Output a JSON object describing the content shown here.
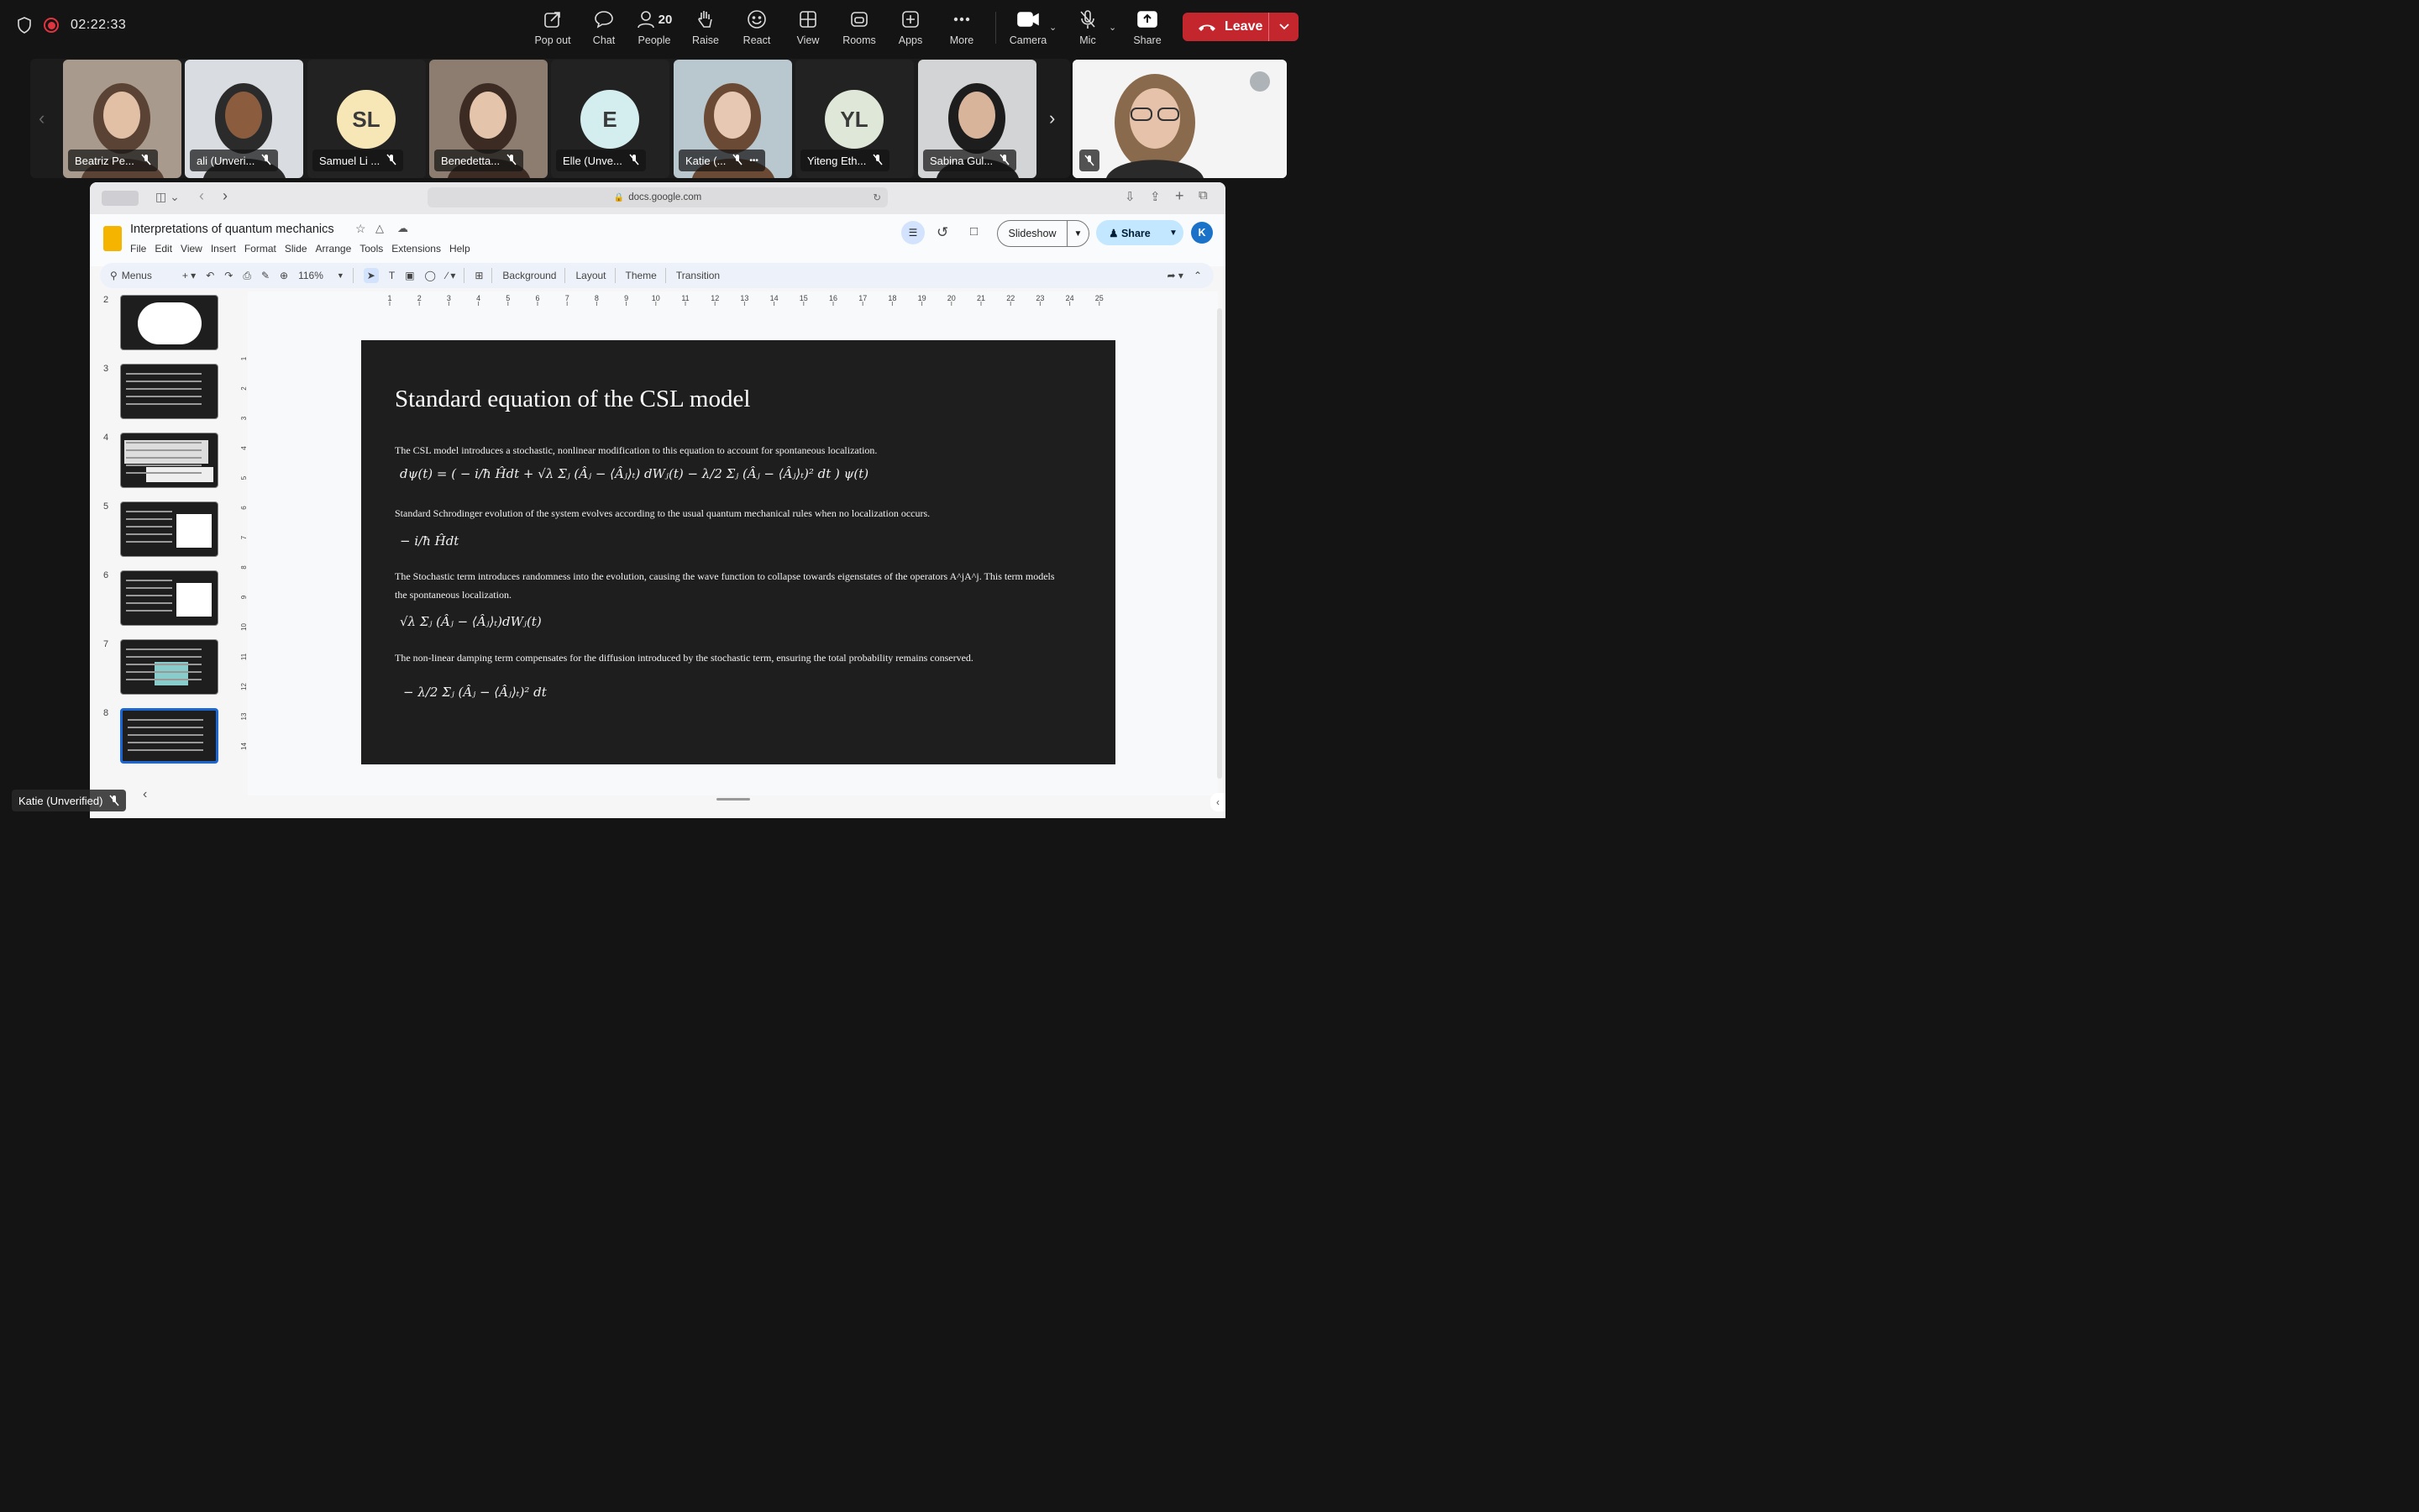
{
  "meeting": {
    "timer": "02:22:33",
    "toolbar": [
      {
        "label": "Pop out",
        "icon": "pop-out-icon"
      },
      {
        "label": "Chat",
        "icon": "chat-icon"
      },
      {
        "label": "People",
        "icon": "people-icon",
        "count": "20"
      },
      {
        "label": "Raise",
        "icon": "raise-hand-icon"
      },
      {
        "label": "React",
        "icon": "react-icon"
      },
      {
        "label": "View",
        "icon": "view-icon"
      },
      {
        "label": "Rooms",
        "icon": "rooms-icon"
      },
      {
        "label": "Apps",
        "icon": "apps-icon"
      },
      {
        "label": "More",
        "icon": "more-icon"
      },
      {
        "label": "Camera",
        "icon": "camera-icon"
      },
      {
        "label": "Mic",
        "icon": "mic-muted-icon"
      },
      {
        "label": "Share",
        "icon": "share-icon"
      }
    ],
    "leave_label": "Leave",
    "leave_color": "#c4262e"
  },
  "participants": [
    {
      "name": "Beatriz Pe...",
      "type": "video"
    },
    {
      "name": "ali (Unveri...",
      "type": "video"
    },
    {
      "name": "Samuel Li ...",
      "type": "avatar",
      "initials": "SL",
      "color": "#f7e7b6"
    },
    {
      "name": "Benedetta...",
      "type": "video"
    },
    {
      "name": "Elle (Unve...",
      "type": "avatar",
      "initials": "E",
      "color": "#d4eef0"
    },
    {
      "name": "Katie (...",
      "type": "video"
    },
    {
      "name": "Yiteng Eth...",
      "type": "avatar",
      "initials": "YL",
      "color": "#dfe8d8"
    },
    {
      "name": "Sabina Gul...",
      "type": "video"
    }
  ],
  "self_label": "Katie (Unverified)",
  "browser": {
    "url": "docs.google.com"
  },
  "docs": {
    "title": "Interpretations of quantum mechanics",
    "menus": [
      "File",
      "Edit",
      "View",
      "Insert",
      "Format",
      "Slide",
      "Arrange",
      "Tools",
      "Extensions",
      "Help"
    ],
    "slideshow_label": "Slideshow",
    "share_label": "Share",
    "account_initial": "K",
    "toolbar": {
      "menus_label": "Menus",
      "zoom": "116%",
      "background": "Background",
      "layout": "Layout",
      "theme": "Theme",
      "transition": "Transition"
    },
    "slide_numbers": [
      "2",
      "3",
      "4",
      "5",
      "6",
      "7",
      "8"
    ],
    "selected_slide": "8",
    "ruler_top": [
      "1",
      "2",
      "3",
      "4",
      "5",
      "6",
      "7",
      "8",
      "9",
      "10",
      "11",
      "12",
      "13",
      "14",
      "15",
      "16",
      "17",
      "18",
      "19",
      "20",
      "21",
      "22",
      "23",
      "24",
      "25"
    ],
    "ruler_left": [
      "1",
      "2",
      "3",
      "4",
      "5",
      "6",
      "7",
      "8",
      "9",
      "10",
      "11",
      "12",
      "13",
      "14"
    ]
  },
  "slide": {
    "title": "Standard equation of the CSL model",
    "p1": "The CSL model introduces a stochastic, nonlinear modification to this equation to account for spontaneous localization.",
    "eq1": "dψ(t) = ( − i/ħ Ĥdt + √λ Σⱼ (Âⱼ − ⟨Âⱼ⟩ₜ) dWⱼ(t) − λ/2 Σⱼ (Âⱼ − ⟨Âⱼ⟩ₜ)² dt ) ψ(t)",
    "p2": "Standard Schrodinger evolution of the system evolves according to the usual quantum mechanical rules when no localization occurs.",
    "eq2": "− i/ħ Ĥdt",
    "p3": "The Stochastic term introduces randomness into the evolution, causing the wave function to collapse towards eigenstates of the operators A^jA^j. This term models the spontaneous localization.",
    "eq3": "√λ Σⱼ (Âⱼ − ⟨Âⱼ⟩ₜ)dWⱼ(t)",
    "p4": "The non-linear damping term compensates for the diffusion introduced by the stochastic term, ensuring the total probability remains conserved.",
    "eq4": "− λ/2 Σⱼ (Âⱼ − ⟨Âⱼ⟩ₜ)² dt"
  }
}
